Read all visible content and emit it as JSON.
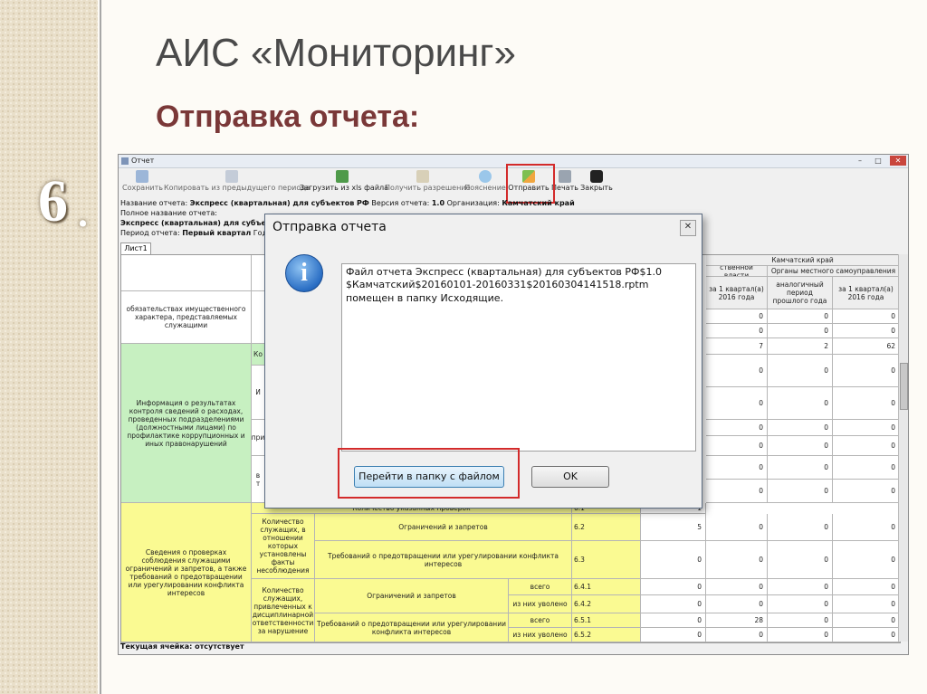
{
  "slide": {
    "title": "АИС «Мониторинг»",
    "subtitle": "Отправка отчета:",
    "step_number": "6",
    "step_dot": "."
  },
  "window": {
    "title": "Отчет",
    "controls": {
      "minimize": "–",
      "maximize": "□",
      "close": "✕"
    }
  },
  "toolbar": {
    "items": [
      {
        "label": "Сохранить",
        "icon": "save-icon"
      },
      {
        "label": "Копировать из предыдущего периода",
        "icon": "copy-icon"
      },
      {
        "label": "Загрузить из xls файла",
        "icon": "excel-icon"
      },
      {
        "label": "Получить разрешение",
        "icon": "permission-icon"
      },
      {
        "label": "Пояснение",
        "icon": "info-icon"
      },
      {
        "label": "Отправить",
        "icon": "send-icon"
      },
      {
        "label": "Печать",
        "icon": "print-icon"
      },
      {
        "label": "Закрыть",
        "icon": "power-icon"
      }
    ],
    "highlight_color": "#d32b2b"
  },
  "report_info": {
    "name_label": "Название отчета:",
    "name_value": "Экспресс (квартальная) для субъектов РФ",
    "version_label": "Версия отчета:",
    "version_value": "1.0",
    "org_label": "Организация:",
    "org_value": "Камчатский край",
    "full_name_label": "Полное название отчета:",
    "full_name_value": "Экспресс (квартальная) для субъектов",
    "period_label": "Период отчета:",
    "period_value": "Первый квартал",
    "year_label": "Год отч"
  },
  "sheet_tab": "Лист1",
  "table": {
    "header_region": "Камчатский край",
    "header_col1": "ственной власти",
    "header_col2": "Органы местного самоуправления",
    "sub_q_a": "за 1 квартал(а) 2016 года",
    "sub_prev": "аналогичный период прошлого года",
    "sub_q_b": "за 1 квартал(а) 2016 года",
    "row_a_text": "обязательствах имущественного характера, представляемых служащими",
    "green_text": "Информация о результатах контроля сведений о расходах, проведенных подразделениями (должностными лицами) по профилактике коррупционных и иных правонарушений",
    "green_sub1": "Ко",
    "green_sub2": "И",
    "green_sub3": "при",
    "green_sub4": "в т",
    "yellow_text": "Сведения о проверках соблюдения служащими ограничений и запретов, а также требований о предотвращении или урегулировании конфликта интересов",
    "count_checks": "Количество указанных проверок",
    "count_facts": "Количество служащих, в отношении которых установлены факты несоблюдения",
    "count_punished": "Количество служащих, привлеченных к дисциплинарной ответственности за нарушение",
    "restrictions": "Ограничений и запретов",
    "requirements": "Требований о предотвращении или урегулировании конфликта интересов",
    "total": "всего",
    "fired": "из них уволено",
    "codes": [
      "6.1",
      "6.2",
      "6.3",
      "6.4.1",
      "6.4.2",
      "6.5.1",
      "6.5.2"
    ],
    "upper_rows": [
      [
        "0",
        "0",
        "0"
      ],
      [
        "0",
        "0",
        "0"
      ],
      [
        "7",
        "2",
        "62"
      ],
      [
        "0",
        "0",
        "0"
      ],
      [
        "0",
        "0",
        "0"
      ],
      [
        "0",
        "0",
        "0"
      ],
      [
        "0",
        "0",
        "0"
      ],
      [
        "0",
        "0",
        "0"
      ],
      [
        "0",
        "0",
        "0"
      ]
    ],
    "lower_rows": [
      [
        "5",
        "0",
        "0",
        "0"
      ],
      [
        "0",
        "0",
        "0",
        "0"
      ],
      [
        "0",
        "0",
        "0",
        "0"
      ],
      [
        "0",
        "0",
        "0",
        "0"
      ],
      [
        "0",
        "28",
        "0",
        "0"
      ],
      [
        "0",
        "0",
        "0",
        "0"
      ]
    ],
    "partial_value": "1"
  },
  "status_bar": "Текущая ячейка: отсутствует",
  "dialog": {
    "title": "Отправка отчета",
    "close": "✕",
    "message_line1": "Файл отчета Экспресс (квартальная) для субъектов РФ$1.0",
    "message_line2": "$Камчатский$20160101-20160331$20160304141518.rptm",
    "message_line3": "помещен в папку Исходящие.",
    "open_folder_button": "Перейти в папку с файлом",
    "ok_button": "OK",
    "icon": "info-icon"
  }
}
